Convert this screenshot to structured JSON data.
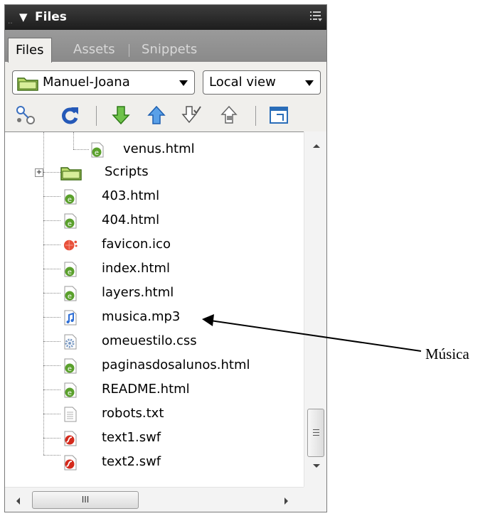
{
  "panel": {
    "title": "Files",
    "tabs": [
      {
        "label": "Files",
        "active": true
      },
      {
        "label": "Assets",
        "active": false
      },
      {
        "label": "Snippets",
        "active": false
      }
    ],
    "site_select": {
      "value": "Manuel-Joana"
    },
    "view_select": {
      "value": "Local view"
    }
  },
  "toolbar": {
    "icons": [
      "connect-icon",
      "refresh-icon",
      "get-files-icon",
      "put-files-icon",
      "check-out-icon",
      "check-in-icon",
      "expand-icon"
    ]
  },
  "tree": {
    "items": [
      {
        "name": "venus.html",
        "icon": "html-file-icon"
      },
      {
        "name": "Scripts",
        "icon": "folder-icon"
      },
      {
        "name": "403.html",
        "icon": "html-file-icon"
      },
      {
        "name": "404.html",
        "icon": "html-file-icon"
      },
      {
        "name": "favicon.ico",
        "icon": "ico-file-icon"
      },
      {
        "name": "index.html",
        "icon": "html-file-icon"
      },
      {
        "name": "layers.html",
        "icon": "html-file-icon"
      },
      {
        "name": "musica.mp3",
        "icon": "audio-file-icon"
      },
      {
        "name": "omeuestilo.css",
        "icon": "css-file-icon"
      },
      {
        "name": "paginasdosalunos.html",
        "icon": "html-file-icon"
      },
      {
        "name": "README.html",
        "icon": "html-file-icon"
      },
      {
        "name": "robots.txt",
        "icon": "text-file-icon"
      },
      {
        "name": "text1.swf",
        "icon": "swf-file-icon"
      },
      {
        "name": "text2.swf",
        "icon": "swf-file-icon"
      }
    ]
  },
  "scrollbar": {
    "h_thumb_glyph": "III",
    "v_thumb_glyph": "≡"
  },
  "annotation": {
    "label": "Música"
  },
  "colors": {
    "html_icon": "#5aa02c",
    "folder": "#b9d96b",
    "swf": "#d42a1c",
    "audio": "#2f6fd6"
  }
}
